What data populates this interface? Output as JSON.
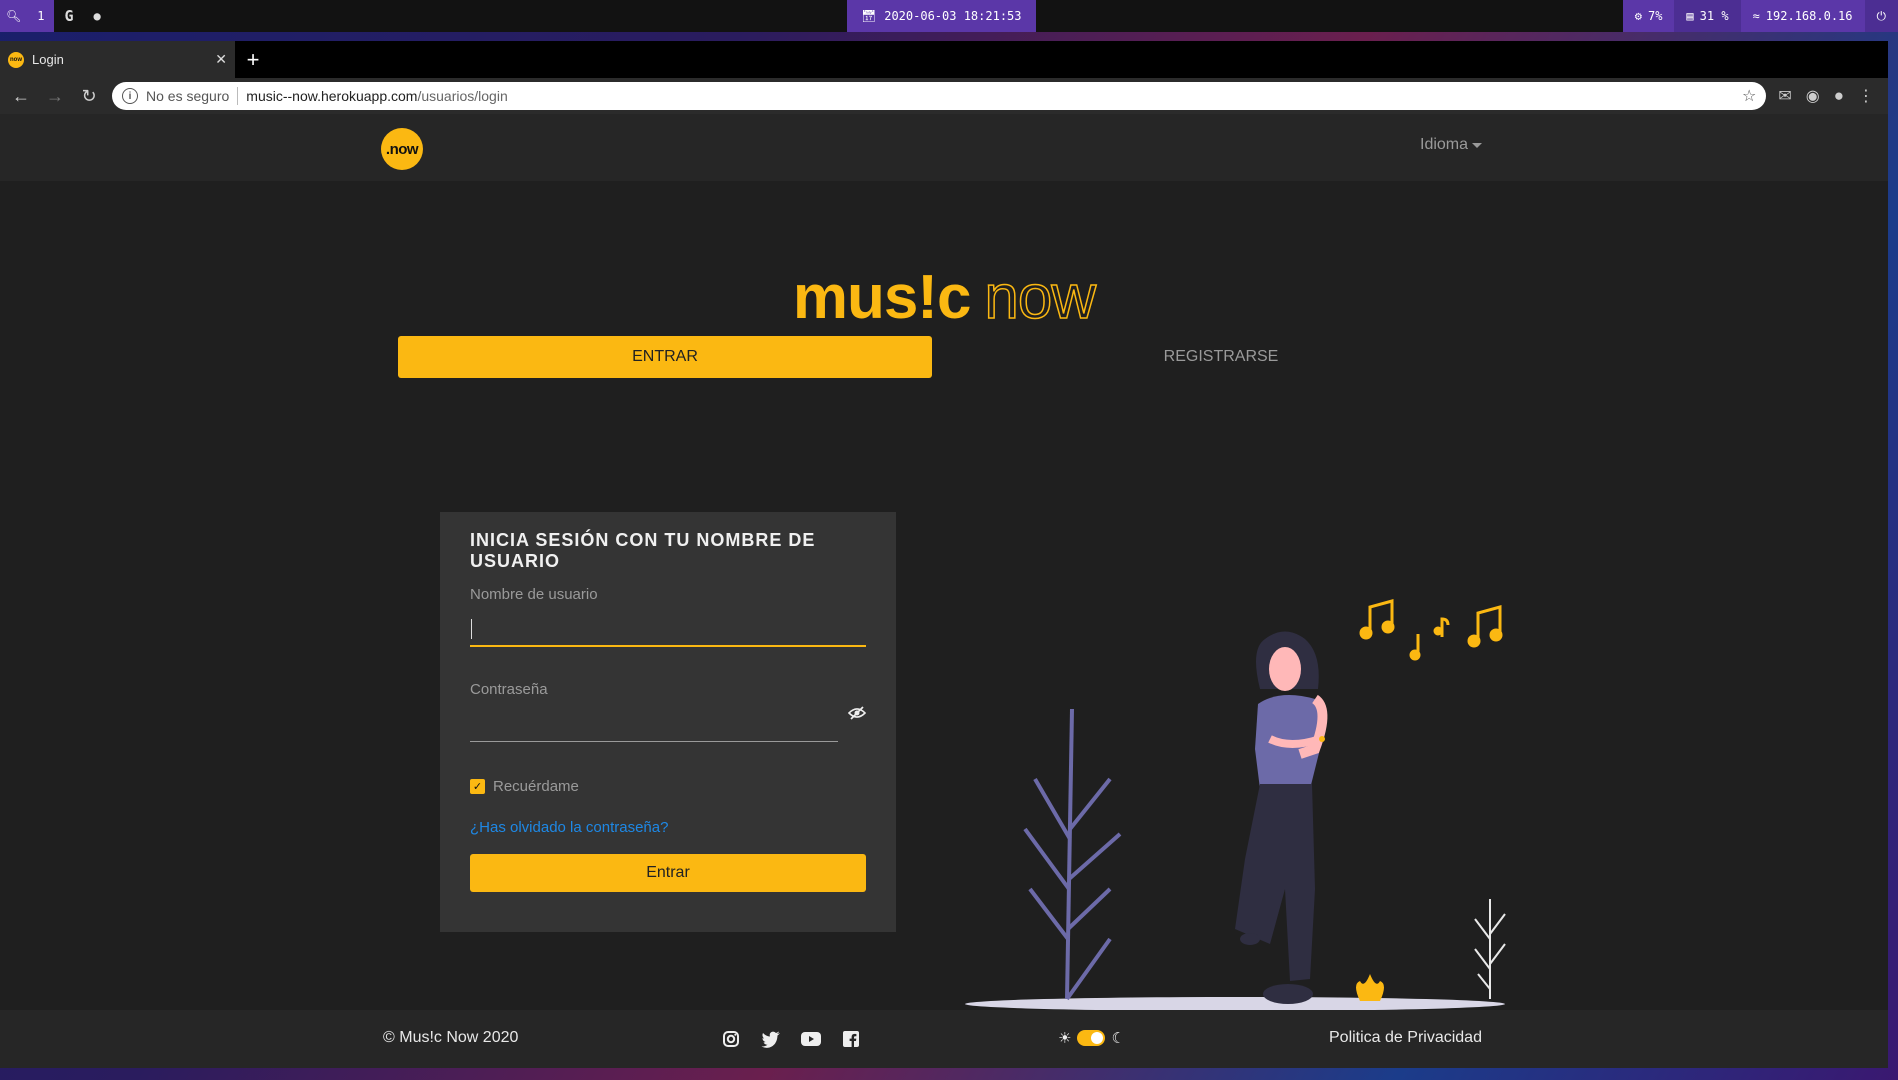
{
  "os_bar": {
    "workspace": "1",
    "datetime": "2020-06-03 18:21:53",
    "cpu": "7%",
    "disk": "31 %",
    "ip": "192.168.0.16"
  },
  "browser": {
    "tab_title": "Login",
    "security_label": "No es seguro",
    "url_host": "music--now.herokuapp.com",
    "url_path": "/usuarios/login"
  },
  "site": {
    "logo_text": ".now",
    "language_menu": "Idioma",
    "brand_bold": "mus!c",
    "brand_outline": "now",
    "tab_login": "ENTRAR",
    "tab_register": "REGISTRARSE"
  },
  "login_form": {
    "title": "INICIA SESIÓN CON TU NOMBRE DE USUARIO",
    "username_label": "Nombre de usuario",
    "username_value": "",
    "password_label": "Contraseña",
    "password_value": "",
    "remember_label": "Recuérdame",
    "remember_checked": true,
    "forgot_link": "¿Has olvidado la contraseña?",
    "submit_label": "Entrar"
  },
  "footer": {
    "copyright": "© Mus!c Now 2020",
    "social_icons": [
      "instagram-icon",
      "twitter-icon",
      "youtube-icon",
      "facebook-icon"
    ],
    "privacy": "Politica de Privacidad"
  },
  "colors": {
    "accent": "#fbb812",
    "page_bg": "#1f1f1f",
    "card_bg": "#343434",
    "link": "#1e88e5"
  }
}
